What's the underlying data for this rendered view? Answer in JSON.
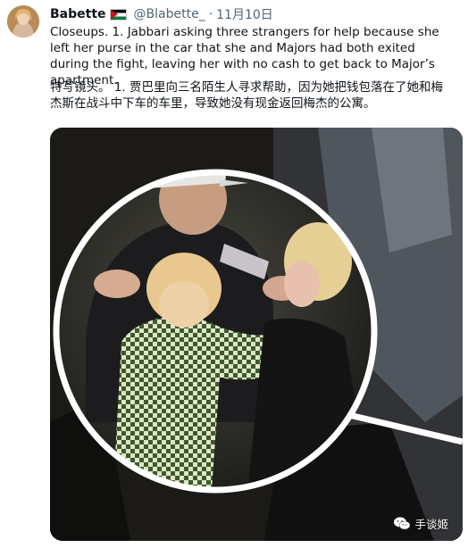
{
  "tweet": {
    "display_name": "Babette",
    "flag_icon": "palestine-flag-icon",
    "handle": "@Blabette_",
    "separator": "·",
    "date": "11月10日",
    "text_en": "Closeups. 1. Jabbari asking three strangers for help because she left her purse in the car that she and Majors had both exited during the fight, leaving her with no cash to get back to Major’s apartment.",
    "text_cn": "特写镜头。 1. 贾巴里向三名陌生人寻求帮助，因为她把钱包落在了她和梅杰斯在战斗中下车的车里，导致她没有现金返回梅杰的公寓。"
  },
  "media": {
    "watermark_icon": "wechat-icon",
    "watermark_text": "手谈姬"
  }
}
